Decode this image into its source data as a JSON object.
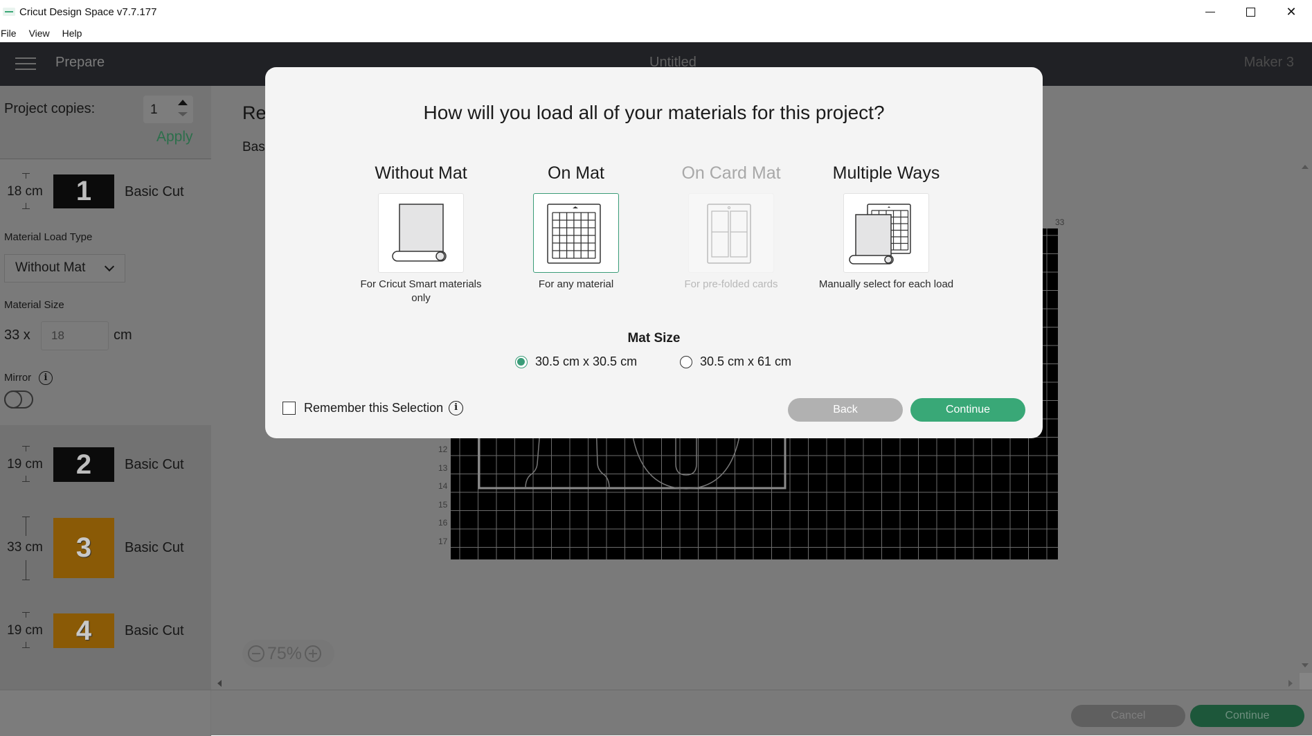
{
  "window": {
    "title": "Cricut Design Space  v7.7.177",
    "minimize_icon": "minimize-icon",
    "maximize_icon": "maximize-icon",
    "close_icon": "close-icon"
  },
  "menu": {
    "items": [
      "File",
      "View",
      "Help"
    ]
  },
  "header": {
    "menu_icon": "hamburger-icon",
    "title": "Prepare",
    "project_name": "Untitled",
    "machine": "Maker 3"
  },
  "left_panel": {
    "copies_label": "Project copies:",
    "copies_value": "1",
    "apply_label": "Apply",
    "mats": [
      {
        "number": "1",
        "length": "18 cm",
        "label": "Basic Cut",
        "color": "#0b0b0b"
      },
      {
        "number": "2",
        "length": "19 cm",
        "label": "Basic Cut",
        "color": "#0b0b0b"
      },
      {
        "number": "3",
        "length": "33 cm",
        "label": "Basic Cut",
        "color": "#8a5a06"
      },
      {
        "number": "4",
        "length": "19 cm",
        "label": "Basic Cut",
        "color": "#8a5a06"
      }
    ],
    "material_load_type_label": "Material Load Type",
    "material_load_type_value": "Without Mat",
    "material_size_label": "Material Size",
    "material_size_width": "33 x",
    "material_size_height": "18",
    "material_size_unit": "cm",
    "mirror_label": "Mirror",
    "mirror_on": false
  },
  "canvas": {
    "title_partial": "Re",
    "subtitle_partial": "Bas",
    "ruler_left": [
      "12",
      "13",
      "14",
      "15",
      "16",
      "17"
    ],
    "ruler_top_last": "33",
    "zoom_level": "75%"
  },
  "bottom_bar": {
    "cancel_label": "Cancel",
    "continue_label": "Continue"
  },
  "modal": {
    "title": "How will you load all of your materials for this project?",
    "options": [
      {
        "title": "Without Mat",
        "description": "For Cricut Smart materials only",
        "icon": "material-roll-icon",
        "state": "normal"
      },
      {
        "title": "On Mat",
        "description": "For any material",
        "icon": "cutting-mat-icon",
        "state": "selected"
      },
      {
        "title": "On Card Mat",
        "description": "For pre-folded cards",
        "icon": "card-mat-icon",
        "state": "disabled"
      },
      {
        "title": "Multiple Ways",
        "description": "Manually select for each load",
        "icon": "multiple-ways-icon",
        "state": "normal"
      }
    ],
    "mat_size_label": "Mat Size",
    "mat_sizes": [
      {
        "label": "30.5 cm x 30.5 cm",
        "selected": true
      },
      {
        "label": "30.5 cm x 61 cm",
        "selected": false
      }
    ],
    "remember_label": "Remember this Selection",
    "remember_checked": false,
    "back_label": "Back",
    "continue_label": "Continue",
    "accent_color": "#39a877"
  }
}
